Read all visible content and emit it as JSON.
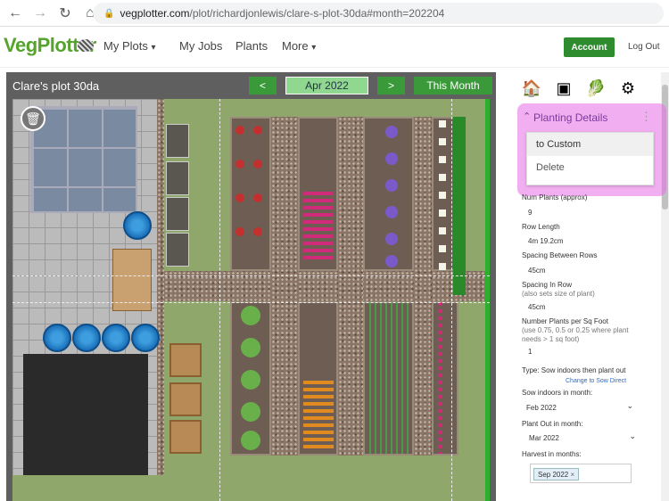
{
  "browser": {
    "url_domain": "vegplotter.com",
    "url_path": "/plot/richardjonlewis/clare-s-plot-30da#month=202204"
  },
  "header": {
    "logo": "VegPlotter",
    "nav": [
      "My Plots",
      "My Jobs",
      "Plants",
      "More"
    ],
    "account": "Account",
    "logout": "Log Out"
  },
  "plot": {
    "title": "Clare's plot 30da",
    "prev": "<",
    "month": "Apr 2022",
    "next": ">",
    "this_month": "This Month"
  },
  "details": {
    "title": "Planting Details",
    "menu": [
      "to Custom",
      "Delete"
    ],
    "num_plants_label": "Num Plants (approx)",
    "num_plants": "9",
    "row_length_label": "Row Length",
    "row_length": "4m 19.2cm",
    "spacing_rows_label": "Spacing Between Rows",
    "spacing_rows": "45cm",
    "spacing_in_row_label": "Spacing In Row",
    "spacing_in_row_sub": "(also sets size of plant)",
    "spacing_in_row": "45cm",
    "per_sqft_label": "Number Plants per Sq Foot",
    "per_sqft_sub": "(use 0.75, 0.5 or 0.25 where plant needs > 1 sq foot)",
    "per_sqft": "1",
    "type_label": "Type: Sow indoors then plant out",
    "change_link": "Change to Sow Direct",
    "sow_indoors_label": "Sow indoors in month:",
    "sow_indoors": "Feb 2022",
    "plant_out_label": "Plant Out in month:",
    "plant_out": "Mar 2022",
    "harvest_label": "Harvest in months:",
    "harvest_tag": "Sep 2022"
  },
  "colors": {
    "brand_green": "#56a32e",
    "button_green": "#3a9a3a",
    "highlight": "#e66ee6"
  },
  "icons": [
    "back-arrow-icon",
    "forward-arrow-icon",
    "reload-icon",
    "home-icon",
    "lock-icon",
    "trash-icon",
    "shed-icon",
    "frame-icon",
    "vegetable-icon",
    "gear-icon",
    "chevron-up-icon",
    "kebab-menu-icon",
    "chevron-down-icon"
  ]
}
